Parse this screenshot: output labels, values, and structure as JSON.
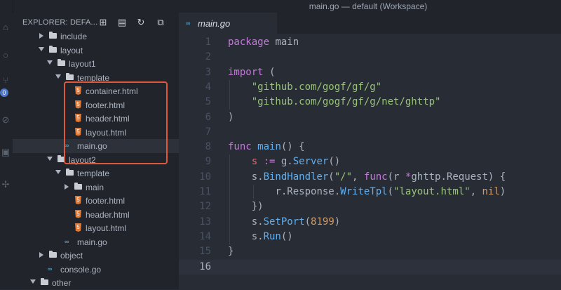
{
  "window": {
    "title": "main.go — default (Workspace)"
  },
  "colors": {
    "keyword": "#c678dd",
    "string": "#98c379",
    "function": "#61afef",
    "variable": "#e06c75",
    "number": "#d19a66",
    "text": "#abb2bf",
    "highlight_box": "#e0573a"
  },
  "activity_bar": {
    "badge_count": "0"
  },
  "sidebar": {
    "title": "EXPLORER: DEFA...",
    "tree": [
      {
        "label": "include",
        "type": "folder",
        "expanded": false,
        "depth": 2
      },
      {
        "label": "layout",
        "type": "folder",
        "expanded": true,
        "depth": 2
      },
      {
        "label": "layout1",
        "type": "folder",
        "expanded": true,
        "depth": 3
      },
      {
        "label": "template",
        "type": "folder",
        "expanded": true,
        "depth": 4
      },
      {
        "label": "container.html",
        "type": "html",
        "depth": 5
      },
      {
        "label": "footer.html",
        "type": "html",
        "depth": 5
      },
      {
        "label": "header.html",
        "type": "html",
        "depth": 5
      },
      {
        "label": "layout.html",
        "type": "html",
        "depth": 5
      },
      {
        "label": "main.go",
        "type": "go",
        "depth": 4,
        "selected": true
      },
      {
        "label": "layout2",
        "type": "folder",
        "expanded": true,
        "depth": 3
      },
      {
        "label": "template",
        "type": "folder",
        "expanded": true,
        "depth": 4
      },
      {
        "label": "main",
        "type": "folder",
        "expanded": false,
        "depth": 5
      },
      {
        "label": "footer.html",
        "type": "html",
        "depth": 5
      },
      {
        "label": "header.html",
        "type": "html",
        "depth": 5
      },
      {
        "label": "layout.html",
        "type": "html",
        "depth": 5
      },
      {
        "label": "main.go",
        "type": "go",
        "depth": 4
      },
      {
        "label": "object",
        "type": "folder",
        "expanded": false,
        "depth": 2
      },
      {
        "label": "console.go",
        "type": "go",
        "depth": 2
      },
      {
        "label": "other",
        "type": "folder",
        "expanded": true,
        "depth": 1
      }
    ]
  },
  "editor": {
    "tab": {
      "label": "main.go",
      "icon": "go-file-icon"
    },
    "current_line": 16,
    "lines": [
      [
        [
          "package",
          "keyword"
        ],
        [
          " main",
          "text"
        ]
      ],
      [],
      [
        [
          "import",
          "keyword"
        ],
        [
          " (",
          "text"
        ]
      ],
      [
        [
          "    ",
          "text"
        ],
        [
          "\"github.com/gogf/gf/g\"",
          "string"
        ]
      ],
      [
        [
          "    ",
          "text"
        ],
        [
          "\"github.com/gogf/gf/g/net/ghttp\"",
          "string"
        ]
      ],
      [
        [
          ")",
          "text"
        ]
      ],
      [],
      [
        [
          "func",
          "keyword"
        ],
        [
          " ",
          "text"
        ],
        [
          "main",
          "function"
        ],
        [
          "() {",
          "text"
        ]
      ],
      [
        [
          "    ",
          "text"
        ],
        [
          "s",
          "variable"
        ],
        [
          " := ",
          "keyword"
        ],
        [
          "g.",
          "text"
        ],
        [
          "Server",
          "function"
        ],
        [
          "()",
          "text"
        ]
      ],
      [
        [
          "    ",
          "text"
        ],
        [
          "s.",
          "text"
        ],
        [
          "BindHandler",
          "function"
        ],
        [
          "(",
          "text"
        ],
        [
          "\"/\"",
          "string"
        ],
        [
          ", ",
          "text"
        ],
        [
          "func",
          "keyword"
        ],
        [
          "(r ",
          "text"
        ],
        [
          "*",
          "keyword"
        ],
        [
          "ghttp.Request) {",
          "text"
        ]
      ],
      [
        [
          "        ",
          "text"
        ],
        [
          "r.Response.",
          "text"
        ],
        [
          "WriteTpl",
          "function"
        ],
        [
          "(",
          "text"
        ],
        [
          "\"layout.html\"",
          "string"
        ],
        [
          ", ",
          "text"
        ],
        [
          "nil",
          "number"
        ],
        [
          ")",
          "text"
        ]
      ],
      [
        [
          "    ",
          "text"
        ],
        [
          "})",
          "text"
        ]
      ],
      [
        [
          "    ",
          "text"
        ],
        [
          "s.",
          "text"
        ],
        [
          "SetPort",
          "function"
        ],
        [
          "(",
          "text"
        ],
        [
          "8199",
          "number"
        ],
        [
          ")",
          "text"
        ]
      ],
      [
        [
          "    ",
          "text"
        ],
        [
          "s.",
          "text"
        ],
        [
          "Run",
          "function"
        ],
        [
          "()",
          "text"
        ]
      ],
      [
        [
          "}",
          "text"
        ]
      ],
      []
    ]
  }
}
